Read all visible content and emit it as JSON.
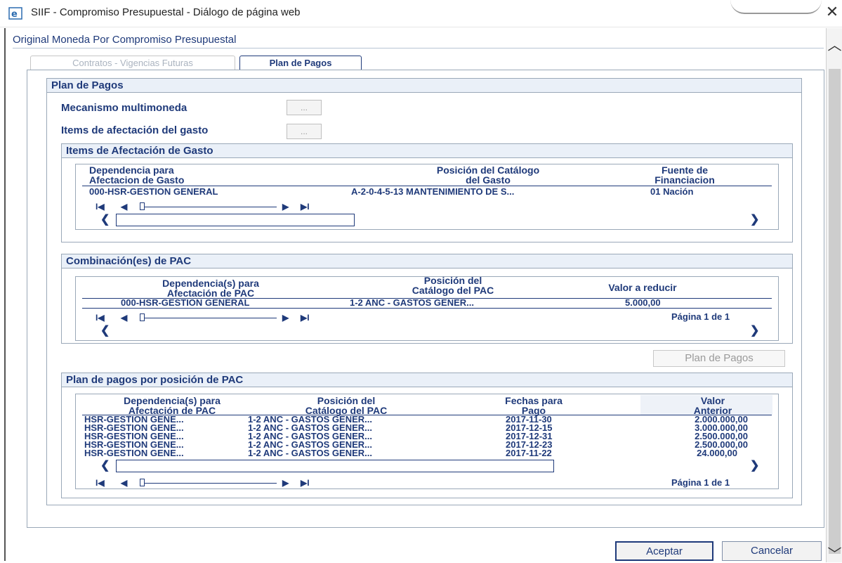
{
  "window": {
    "title": "SIIF - Compromiso Presupuestal - Diálogo de página web",
    "close_glyph": "✕"
  },
  "app": {
    "header": "Original Moneda Por Compromiso Presupuestal"
  },
  "tabs": [
    {
      "label": "Contratos - Vigencias Futuras",
      "state": "disabled"
    },
    {
      "label": "Plan de Pagos",
      "state": "active"
    }
  ],
  "plan_pagos": {
    "title": "Plan de Pagos",
    "fields": [
      {
        "label": "Mecanismo multimoneda",
        "button": "..."
      },
      {
        "label": "Items de afectación del gasto",
        "button": "..."
      }
    ]
  },
  "items_afectacion": {
    "title": "Items de Afectación de Gasto",
    "columns": [
      [
        "Dependencia para",
        "Afectacion de Gasto"
      ],
      [
        "Posición del Catálogo",
        "del Gasto"
      ],
      [
        "Fuente de",
        "Financiacion"
      ]
    ],
    "rows": [
      [
        "000-HSR-GESTION GENERAL",
        "A-2-0-4-5-13 MANTENIMIENTO DE S...",
        "01 Nación"
      ]
    ]
  },
  "combinacion_pac": {
    "title": "Combinación(es) de PAC",
    "columns": [
      [
        "Dependencia(s) para",
        "Afectación de PAC"
      ],
      [
        "Posición del",
        "Catálogo del PAC"
      ],
      [
        "Valor a reducir",
        ""
      ]
    ],
    "rows": [
      [
        "000-HSR-GESTION GENERAL",
        "1-2 ANC - GASTOS GENER...",
        "5.000,00"
      ]
    ],
    "pager": "Página 1 de 1"
  },
  "plan_pagos_button": "Plan de Pagos",
  "plan_posicion_pac": {
    "title": "Plan de pagos por posición de PAC",
    "columns": [
      [
        "Dependencia(s) para",
        "Afectación de PAC"
      ],
      [
        "Posición del",
        "Catálogo del PAC"
      ],
      [
        "Fechas para",
        "Pago"
      ],
      [
        "Valor",
        "Anterior"
      ]
    ],
    "rows": [
      [
        "HSR-GESTION GENE...",
        "1-2 ANC - GASTOS GENER...",
        "2017-11-30",
        "2.000.000,00"
      ],
      [
        "HSR-GESTION GENE...",
        "1-2 ANC - GASTOS GENER...",
        "2017-12-15",
        "3.000.000,00"
      ],
      [
        "HSR-GESTION GENE...",
        "1-2 ANC - GASTOS GENER...",
        "2017-12-31",
        "2.500.000,00"
      ],
      [
        "HSR-GESTION GENE...",
        "1-2 ANC - GASTOS GENER...",
        "2017-12-23",
        "2.500.000,00"
      ],
      [
        "HSR-GESTION GENE...",
        "1-2 ANC - GASTOS GENER...",
        "2017-11-22",
        "24.000,00"
      ]
    ],
    "pager": "Página 1 de 1"
  },
  "footer": {
    "accept": "Aceptar",
    "cancel": "Cancelar"
  },
  "nav_glyphs": {
    "first": "I◀",
    "prev": "◀",
    "next": "▶",
    "last": "▶I",
    "left": "❮",
    "right": "❯"
  },
  "colors": {
    "text": "#1f3a7a",
    "border": "#9aa8b8",
    "group_head_bg": "#eaf0f8"
  }
}
